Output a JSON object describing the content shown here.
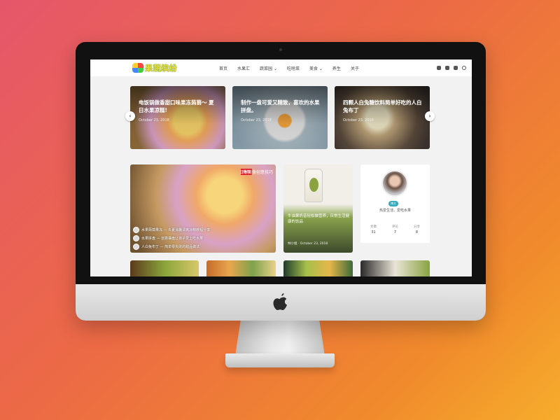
{
  "site": {
    "logo_text": "果蔬缤纷",
    "menu": [
      "首页",
      "水果汇",
      "蔬菜园 ⌄",
      "吃啥菜",
      "美食 ⌄",
      "养生",
      "关于"
    ]
  },
  "slider": [
    {
      "title": "电饭锅做香甜口味果冻蒟蒻～ 夏日水果凉糕!",
      "date": "October 23, 2018"
    },
    {
      "title": "制作一盘可爱又精致，喜欢的水果拼盘。",
      "date": "October 23, 2018"
    },
    {
      "title": "四颗人白兔糖饮料简单好吃的人白兔布丁",
      "date": "October 23, 2018"
    }
  ],
  "feature": {
    "tag": "推荐",
    "heading": "日本美食创意技巧",
    "items": [
      "水果蒟蒻果冻 — 炎夏消暑清爽凉糕教程分享",
      "水果拼盘 — 创意摆盘让孩子爱上吃水果",
      "人白兔布丁 — 简单零失败的甜品做法"
    ]
  },
  "card2": {
    "title": "牛油果奶昔轻松做营养，日常生活健康的饮品",
    "meta": "林小姐 · October 23, 2018"
  },
  "profile": {
    "badge": "博主",
    "bio": "热爱生活，爱吃水果",
    "stats": [
      {
        "label": "文章",
        "value": "31"
      },
      {
        "label": "评论",
        "value": "7"
      },
      {
        "label": "分享",
        "value": "8"
      }
    ]
  }
}
